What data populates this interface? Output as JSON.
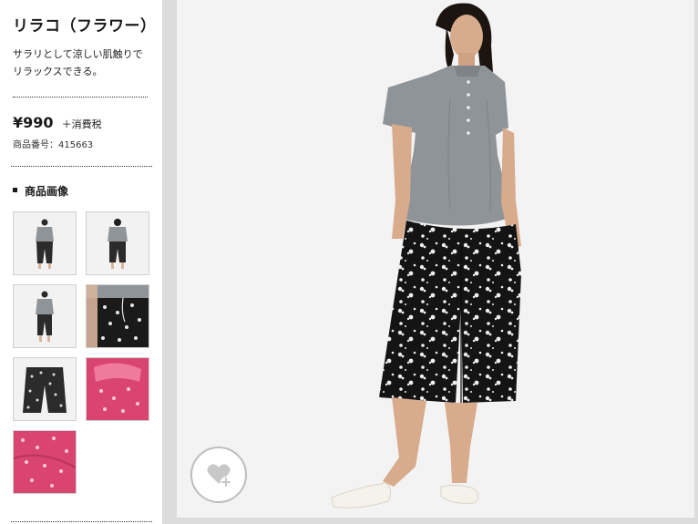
{
  "product": {
    "name": "リラコ（フラワー）",
    "description": [
      "サラリとして涼しい肌触りで",
      "リラックスできる。"
    ],
    "price": "¥990",
    "tax_note": "＋消費税",
    "product_number": "商品番号：415663"
  },
  "gallery": {
    "heading": "商品画像",
    "thumbnails": [
      {
        "view": "model-front"
      },
      {
        "view": "model-back"
      },
      {
        "view": "model-front-2"
      },
      {
        "view": "waist-detail"
      },
      {
        "view": "flat-pants"
      },
      {
        "view": "pink-detail"
      },
      {
        "view": "pink-fabric"
      }
    ]
  },
  "actions": {
    "favorite_icon": "heart-plus-icon"
  },
  "colors": {
    "pattern_dark": "#141414",
    "shirt": "#8f9499",
    "pink": "#d9456f",
    "stage": "#f3f3f3",
    "band": "#dcdcdc"
  }
}
